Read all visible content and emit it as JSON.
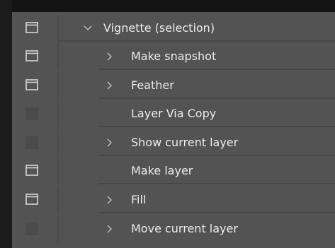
{
  "actions_panel": {
    "set": {
      "label": "Vignette (selection)",
      "toggle": "on",
      "expanded": true
    },
    "steps": [
      {
        "label": "Make snapshot",
        "toggle": "on",
        "has_children": true
      },
      {
        "label": "Feather",
        "toggle": "on",
        "has_children": true
      },
      {
        "label": "Layer Via Copy",
        "toggle": "off",
        "has_children": false
      },
      {
        "label": "Show current layer",
        "toggle": "off",
        "has_children": true
      },
      {
        "label": "Make layer",
        "toggle": "on",
        "has_children": false
      },
      {
        "label": "Fill",
        "toggle": "on",
        "has_children": true
      },
      {
        "label": "Move current layer",
        "toggle": "off",
        "has_children": true
      }
    ]
  },
  "colors": {
    "panel_bg": "#535353",
    "text": "#ececec",
    "icon": "#d6d6d6",
    "frame": "#151515"
  }
}
